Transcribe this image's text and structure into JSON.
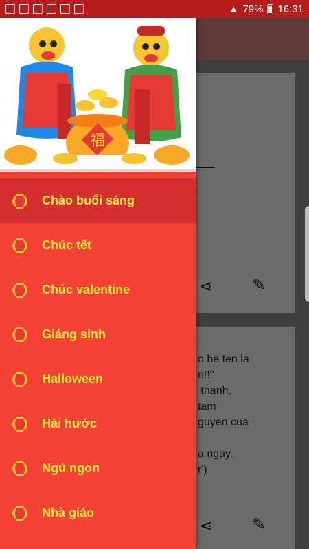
{
  "status_bar": {
    "battery": "79%",
    "time": "16:31"
  },
  "drawer": {
    "menu": [
      {
        "label": "Chào buổi sáng",
        "active": true
      },
      {
        "label": "Chúc tết"
      },
      {
        "label": "Chúc valentine"
      },
      {
        "label": "Giáng sinh"
      },
      {
        "label": "Halloween"
      },
      {
        "label": "Hài hước"
      },
      {
        "label": "Ngủ ngon"
      },
      {
        "label": "Nhà giáo"
      }
    ]
  },
  "background": {
    "card2_text": "o be ten la\nn!!\"\n thanh,\ntam\nguyen cua\n\na ngay.\nr')"
  },
  "colors": {
    "drawer": "#f44336",
    "active_item": "#d32f2f",
    "label": "#ffeb3b",
    "status_bar": "#b71c1c"
  }
}
